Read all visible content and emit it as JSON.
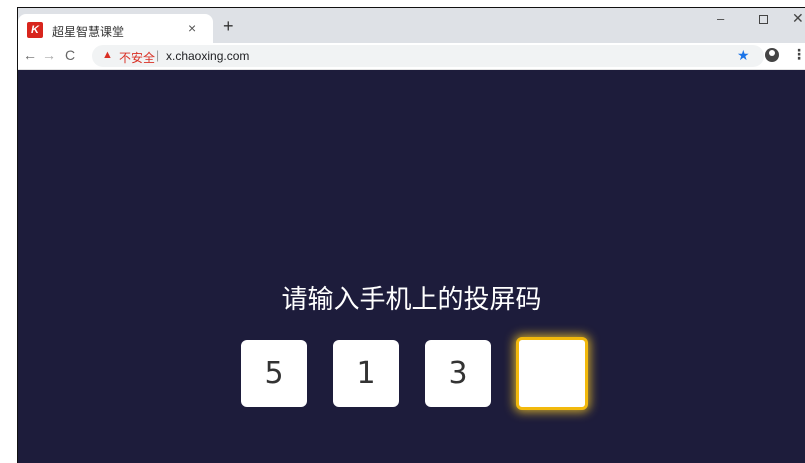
{
  "browser": {
    "tab_title": "超星智慧课堂",
    "tab_favicon": "chaoxing-logo-icon",
    "tab_close": "×",
    "new_tab": "+",
    "window_min": "–",
    "window_close": "✕",
    "nav_back": "←",
    "nav_forward": "→",
    "nav_reload": "C",
    "security_icon": "▲",
    "security_label": "不安全",
    "url_divider": "|",
    "url": "x.chaoxing.com",
    "bookmark_star": "★",
    "menu": "⋮"
  },
  "page": {
    "prompt": "请输入手机上的投屏码",
    "code_digits": [
      "5",
      "1",
      "3",
      ""
    ],
    "active_box_color": "#f2b90c",
    "background_color": "#1d1c3b"
  }
}
